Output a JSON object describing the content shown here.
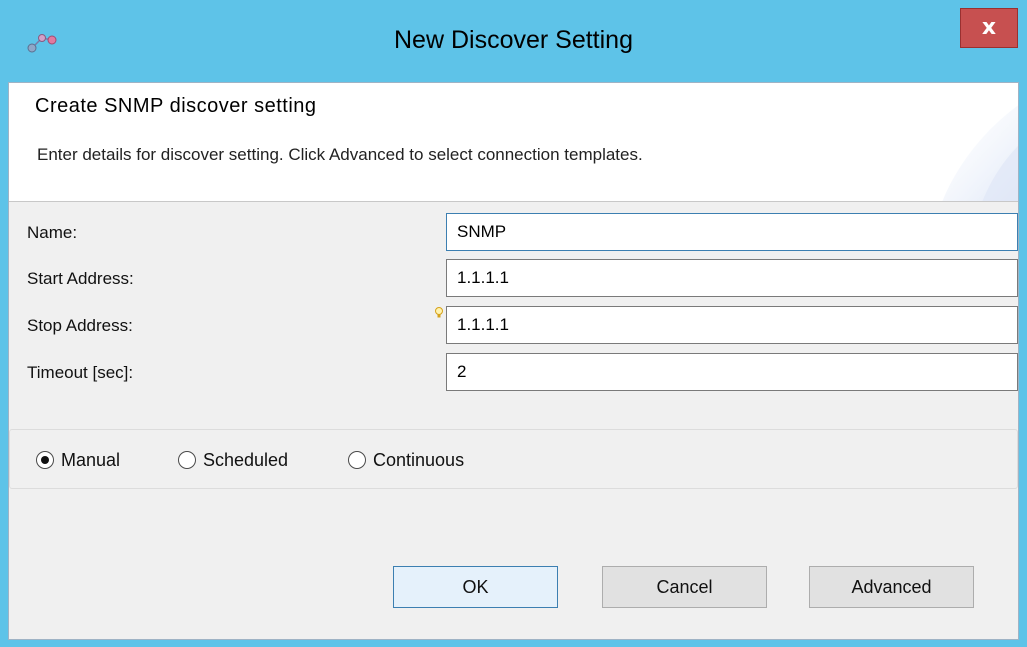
{
  "window": {
    "title": "New Discover Setting",
    "close_label": "x"
  },
  "header": {
    "title": "Create SNMP discover setting",
    "description": "Enter details for discover setting. Click Advanced to select connection templates."
  },
  "form": {
    "name_label": "Name:",
    "name_value": "SNMP",
    "start_label": "Start Address:",
    "start_value": "1.1.1.1",
    "stop_label": "Stop Address:",
    "stop_value": "1.1.1.1",
    "timeout_label": "Timeout [sec]:",
    "timeout_value": "2"
  },
  "schedule": {
    "options": [
      "Manual",
      "Scheduled",
      "Continuous"
    ],
    "selected": "Manual"
  },
  "buttons": {
    "ok": "OK",
    "cancel": "Cancel",
    "advanced": "Advanced"
  },
  "colors": {
    "titlebar": "#5ec3e8",
    "close_button": "#c75050",
    "dialog_body": "#f0f0f0",
    "default_button_border": "#3c7fb1"
  }
}
